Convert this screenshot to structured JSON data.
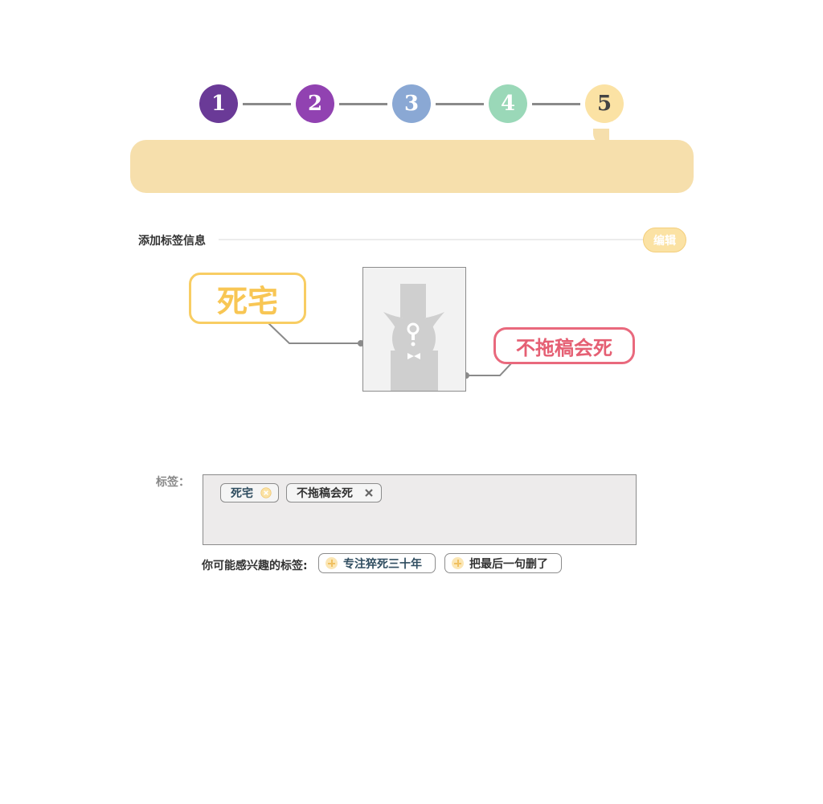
{
  "steps": [
    {
      "label": "1",
      "color": "#6a3a97"
    },
    {
      "label": "2",
      "color": "#9142b1"
    },
    {
      "label": "3",
      "color": "#8aa8d4"
    },
    {
      "label": "4",
      "color": "#9ad8b8"
    },
    {
      "label": "5",
      "color": "#fbe2a4"
    }
  ],
  "section": {
    "title": "添加标签信息",
    "edit_label": "编辑"
  },
  "diagram": {
    "tag_left": "死宅",
    "tag_right": "不拖稿会死",
    "avatar_icon": "mystery-gentleman-icon"
  },
  "tags": {
    "label": "标签：",
    "chips": [
      {
        "text": "死宅",
        "remove_icon": "close-circle-icon"
      },
      {
        "text": "不拖稿会死",
        "remove_icon": "close-icon"
      }
    ]
  },
  "suggestions": {
    "label": "你可能感兴趣的标签:",
    "items": [
      {
        "text": "专注猝死三十年",
        "icon": "plus-circle-icon"
      },
      {
        "text": "把最后一句删了",
        "icon": "plus-circle-icon"
      }
    ]
  },
  "colors": {
    "accent": "#f6dfac",
    "tag_yellow": "#f8cd63",
    "tag_red": "#e9697d"
  }
}
